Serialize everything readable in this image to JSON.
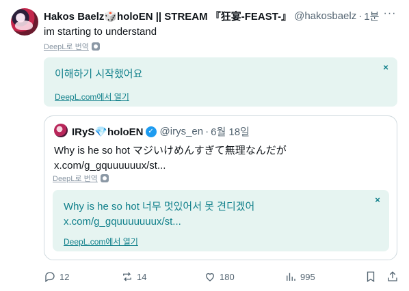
{
  "tweet": {
    "author_name": "Hakos Baelz🎲holoEN || STREAM 『狂宴-FEAST-』",
    "handle": "@hakosbaelz",
    "time": "1분",
    "more_label": "···",
    "text": "im starting to understand",
    "translate_link": "DeepL로 번역",
    "translation": {
      "text": "이해하기 시작했어요",
      "open_link": "DeepL.com에서 열기",
      "close_label": "×"
    }
  },
  "quote": {
    "author_name": "IRyS💎holoEN",
    "verified_label": "✓",
    "handle": "@irys_en",
    "time": "6월 18일",
    "text_line1": "Why is he so hot マジいけめんすぎて無理なんだが",
    "text_line2": "x.com/g_gquuuuuux/st...",
    "translate_link": "DeepL로 번역",
    "translation": {
      "line1": "Why is he so hot 너무 멋있어서 못 견디겠어",
      "line2": "x.com/g_gquuuuuuux/st...",
      "open_link": "DeepL.com에서 열기",
      "close_label": "×"
    }
  },
  "actions": {
    "replies": "12",
    "reposts": "14",
    "likes": "180",
    "views": "995"
  },
  "colors": {
    "translation_bg": "#e6f4f1",
    "translation_text": "#0f7f8a",
    "secondary_text": "#536471",
    "verified": "#1d9bf0"
  }
}
